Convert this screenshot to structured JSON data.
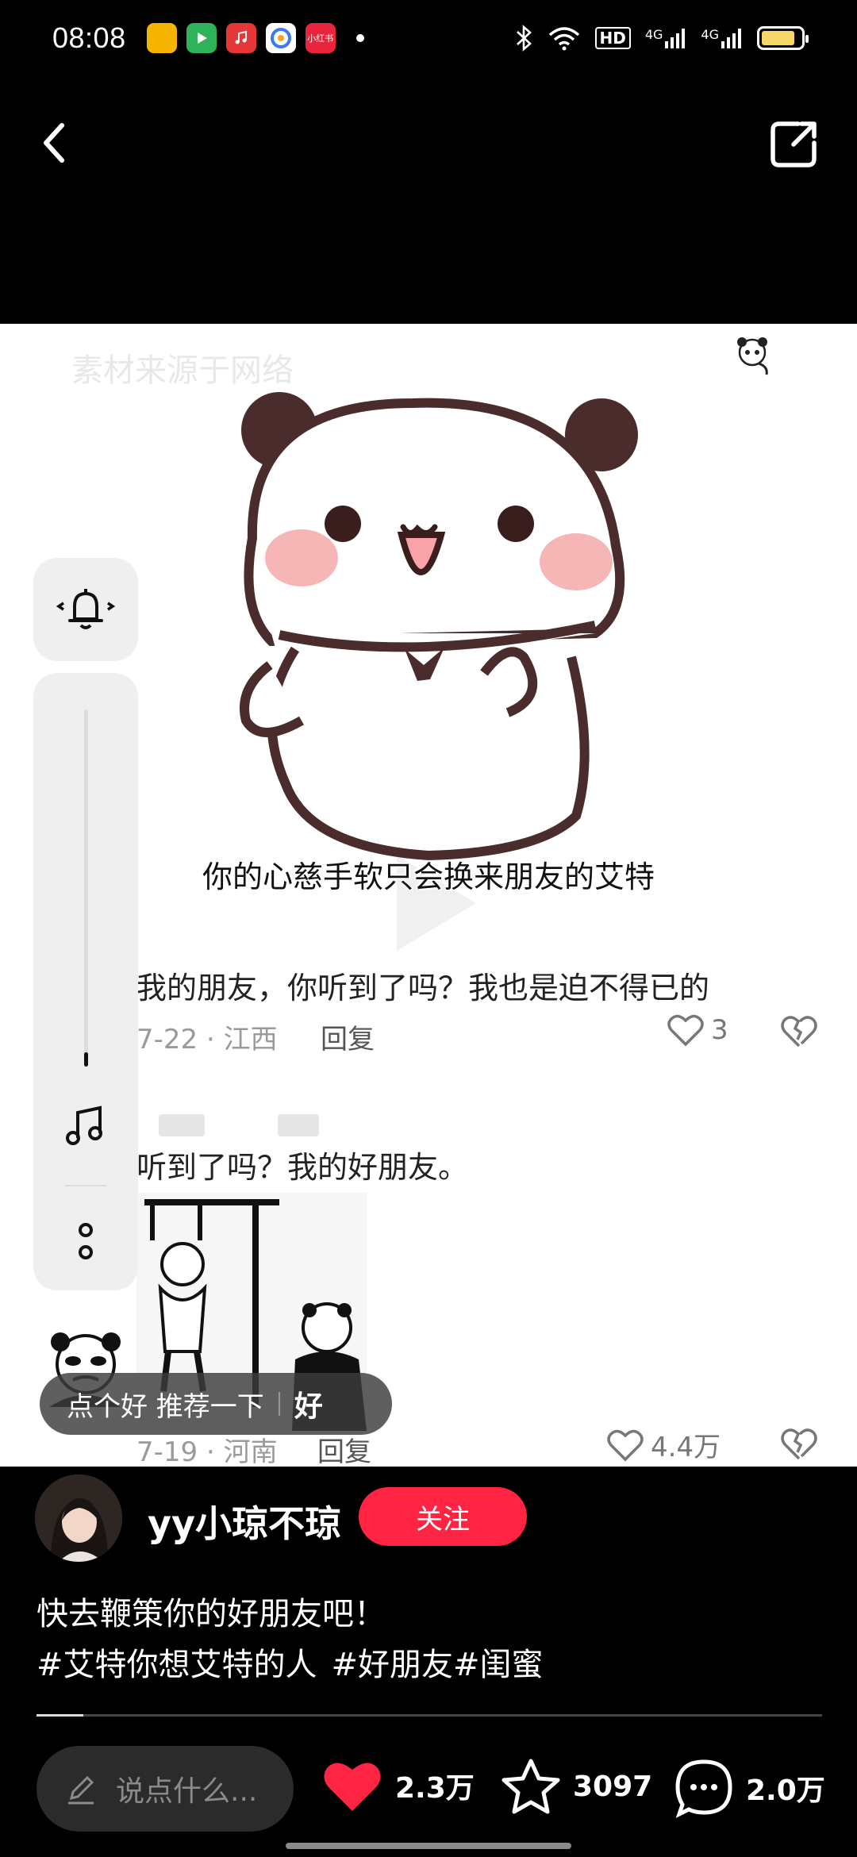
{
  "status_bar": {
    "time": "08:08",
    "app_chips": [
      {
        "name": "files-app-icon",
        "color": "#f5b400",
        "text": ""
      },
      {
        "name": "video-app-icon",
        "color": "#2fb35a",
        "text": ""
      },
      {
        "name": "music-app-icon",
        "color": "#e73838",
        "text": ""
      },
      {
        "name": "browser-app-icon",
        "color": "#3a7bf5",
        "text": ""
      },
      {
        "name": "xiaohongshu-app-icon",
        "color": "#e8253c",
        "text": "小红书"
      }
    ],
    "network_label": "HD",
    "signal_1": "4G",
    "signal_2": "4G",
    "battery_level": 0.85,
    "battery_color": "#f4d86a"
  },
  "nav": {
    "back_icon": "back-arrow-icon",
    "share_icon": "share-icon"
  },
  "media": {
    "watermark": "素材来源于网络",
    "subtitle": "你的心慈手软只会换来朋友的艾特",
    "comments": [
      {
        "text": "我的朋友，你听到了吗？我也是迫不得已的",
        "meta": "7-22 · 江西",
        "reply": "回复",
        "likes": "3"
      },
      {
        "text": "听到了吗？我的好朋友。",
        "meta": "7-19 · 河南",
        "reply": "回复",
        "likes": "4.4万"
      }
    ],
    "recommend": {
      "label": "点个好 推荐一下",
      "icon_text": "好"
    },
    "volume_level": 0.04
  },
  "author": {
    "name": "yy小琼不琼",
    "follow_label": "关注"
  },
  "post": {
    "caption": "快去鞭策你的好朋友吧！",
    "tags": [
      "#艾特你想艾特的人",
      "#好朋友",
      "#闺蜜"
    ],
    "progress": 0.06
  },
  "bottom_bar": {
    "input_placeholder": "说点什么...",
    "likes": "2.3万",
    "favorites": "3097",
    "comments": "2.0万",
    "like_color": "#ff2442"
  }
}
